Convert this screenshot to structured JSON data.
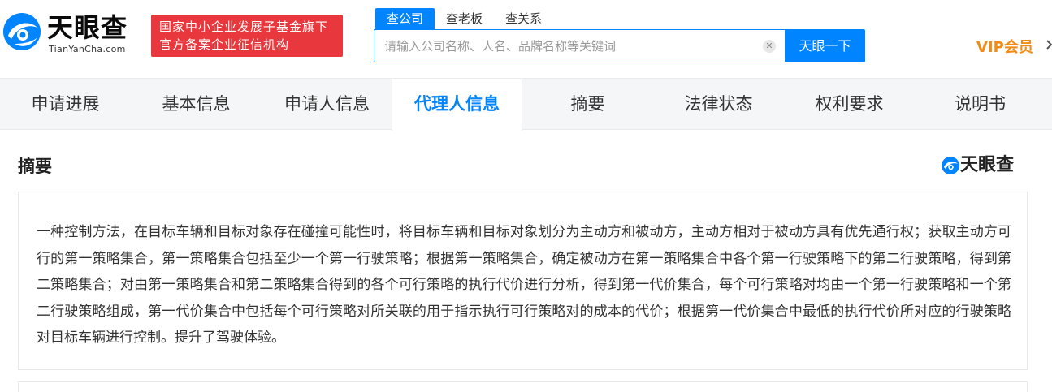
{
  "header": {
    "logo_cn": "天眼查",
    "logo_en": "TianYanCha.com",
    "badge_line1": "国家中小企业发展子基金旗下",
    "badge_line2": "官方备案企业征信机构",
    "search_tabs": [
      "查公司",
      "查老板",
      "查关系"
    ],
    "search_placeholder": "请输入公司名称、人名、品牌名称等关键词",
    "search_button": "天眼一下",
    "vip_label": "VIP会员"
  },
  "tabs": [
    "申请进展",
    "基本信息",
    "申请人信息",
    "代理人信息",
    "摘要",
    "法律状态",
    "权利要求",
    "说明书"
  ],
  "active_tab": "代理人信息",
  "section": {
    "title": "摘要",
    "watermark": "天眼查",
    "abstract": "一种控制方法，在目标车辆和目标对象存在碰撞可能性时，将目标车辆和目标对象划分为主动方和被动方，主动方相对于被动方具有优先通行权；获取主动方可行的第一策略集合，第一策略集合包括至少一个第一行驶策略；根据第一策略集合，确定被动方在第一策略集合中各个第一行驶策略下的第二行驶策略，得到第二策略集合；对由第一策略集合和第二策略集合得到的各个可行策略的执行代价进行分析，得到第一代价集合，每个可行策略对均由一个第一行驶策略和一个第二行驶策略组成，第一代价集合中包括每个可行策略对所关联的用于指示执行可行策略对的成本的代价；根据第一代价集合中最低的执行代价所对应的行驶策略对目标车辆进行控制。提升了驾驶体验。"
  },
  "colors": {
    "brand_blue": "#0084ff",
    "badge_red": "#e8383d",
    "vip_orange": "#f08b16"
  },
  "icons": {
    "logo": "tianyancha-eye-logo",
    "clear": "close-circle-icon",
    "vip_caret": "chevron-right-icon"
  }
}
